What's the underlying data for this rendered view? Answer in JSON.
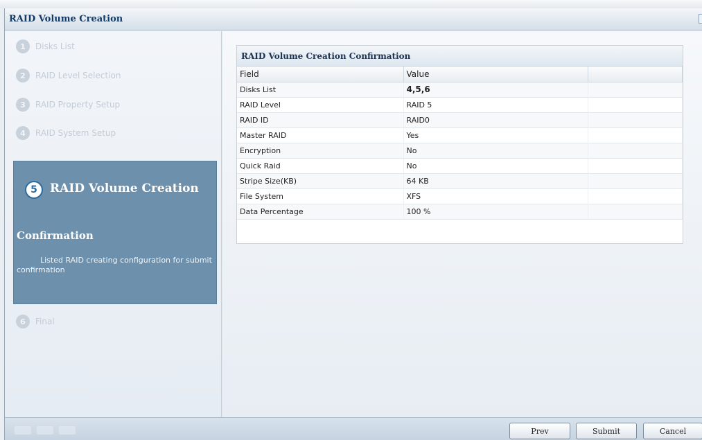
{
  "window": {
    "title": "RAID Volume Creation"
  },
  "steps": [
    {
      "num": "1",
      "label": "Disks List"
    },
    {
      "num": "2",
      "label": "RAID Level Selection"
    },
    {
      "num": "3",
      "label": "RAID Property Setup"
    },
    {
      "num": "4",
      "label": "RAID System Setup"
    },
    {
      "num": "5",
      "label": "RAID Volume Creation"
    },
    {
      "num": "6",
      "label": "Final"
    }
  ],
  "active_step": {
    "num": "5",
    "title": "RAID Volume Creation",
    "subtitle": "Confirmation",
    "description": "Listed RAID creating configuration for submit confirmation"
  },
  "panel": {
    "title": "RAID Volume Creation Confirmation",
    "columns": [
      "Field",
      "Value"
    ],
    "rows": [
      {
        "field": "Disks List",
        "value": "4,5,6"
      },
      {
        "field": "RAID Level",
        "value": "RAID 5"
      },
      {
        "field": "RAID ID",
        "value": "RAID0"
      },
      {
        "field": "Master RAID",
        "value": "Yes"
      },
      {
        "field": "Encryption",
        "value": "No"
      },
      {
        "field": "Quick Raid",
        "value": "No"
      },
      {
        "field": "Stripe Size(KB)",
        "value": "64 KB"
      },
      {
        "field": "File System",
        "value": "XFS"
      },
      {
        "field": "Data Percentage",
        "value": "100 %"
      }
    ]
  },
  "footer": {
    "prev_label": "Prev",
    "submit_label": "Submit",
    "cancel_label": "Cancel"
  },
  "colors": {
    "active_step_bg": "#6d90ac",
    "title_text": "#143a66"
  }
}
